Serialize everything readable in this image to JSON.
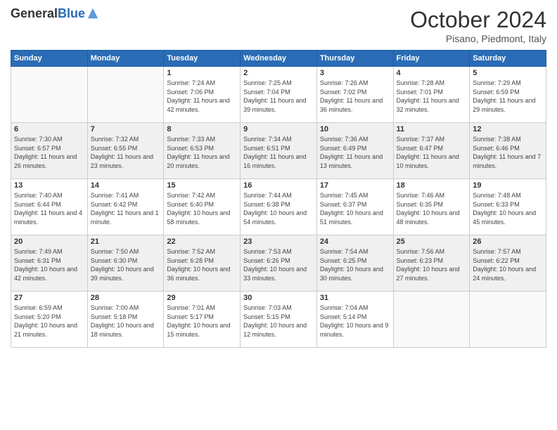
{
  "header": {
    "logo_general": "General",
    "logo_blue": "Blue",
    "title": "October 2024",
    "location": "Pisano, Piedmont, Italy"
  },
  "weekdays": [
    "Sunday",
    "Monday",
    "Tuesday",
    "Wednesday",
    "Thursday",
    "Friday",
    "Saturday"
  ],
  "weeks": [
    {
      "shade": false,
      "days": [
        {
          "num": "",
          "info": ""
        },
        {
          "num": "",
          "info": ""
        },
        {
          "num": "1",
          "info": "Sunrise: 7:24 AM\nSunset: 7:06 PM\nDaylight: 11 hours and 42 minutes."
        },
        {
          "num": "2",
          "info": "Sunrise: 7:25 AM\nSunset: 7:04 PM\nDaylight: 11 hours and 39 minutes."
        },
        {
          "num": "3",
          "info": "Sunrise: 7:26 AM\nSunset: 7:02 PM\nDaylight: 11 hours and 36 minutes."
        },
        {
          "num": "4",
          "info": "Sunrise: 7:28 AM\nSunset: 7:01 PM\nDaylight: 11 hours and 32 minutes."
        },
        {
          "num": "5",
          "info": "Sunrise: 7:29 AM\nSunset: 6:59 PM\nDaylight: 11 hours and 29 minutes."
        }
      ]
    },
    {
      "shade": true,
      "days": [
        {
          "num": "6",
          "info": "Sunrise: 7:30 AM\nSunset: 6:57 PM\nDaylight: 11 hours and 26 minutes."
        },
        {
          "num": "7",
          "info": "Sunrise: 7:32 AM\nSunset: 6:55 PM\nDaylight: 11 hours and 23 minutes."
        },
        {
          "num": "8",
          "info": "Sunrise: 7:33 AM\nSunset: 6:53 PM\nDaylight: 11 hours and 20 minutes."
        },
        {
          "num": "9",
          "info": "Sunrise: 7:34 AM\nSunset: 6:51 PM\nDaylight: 11 hours and 16 minutes."
        },
        {
          "num": "10",
          "info": "Sunrise: 7:36 AM\nSunset: 6:49 PM\nDaylight: 11 hours and 13 minutes."
        },
        {
          "num": "11",
          "info": "Sunrise: 7:37 AM\nSunset: 6:47 PM\nDaylight: 11 hours and 10 minutes."
        },
        {
          "num": "12",
          "info": "Sunrise: 7:38 AM\nSunset: 6:46 PM\nDaylight: 11 hours and 7 minutes."
        }
      ]
    },
    {
      "shade": false,
      "days": [
        {
          "num": "13",
          "info": "Sunrise: 7:40 AM\nSunset: 6:44 PM\nDaylight: 11 hours and 4 minutes."
        },
        {
          "num": "14",
          "info": "Sunrise: 7:41 AM\nSunset: 6:42 PM\nDaylight: 11 hours and 1 minute."
        },
        {
          "num": "15",
          "info": "Sunrise: 7:42 AM\nSunset: 6:40 PM\nDaylight: 10 hours and 58 minutes."
        },
        {
          "num": "16",
          "info": "Sunrise: 7:44 AM\nSunset: 6:38 PM\nDaylight: 10 hours and 54 minutes."
        },
        {
          "num": "17",
          "info": "Sunrise: 7:45 AM\nSunset: 6:37 PM\nDaylight: 10 hours and 51 minutes."
        },
        {
          "num": "18",
          "info": "Sunrise: 7:46 AM\nSunset: 6:35 PM\nDaylight: 10 hours and 48 minutes."
        },
        {
          "num": "19",
          "info": "Sunrise: 7:48 AM\nSunset: 6:33 PM\nDaylight: 10 hours and 45 minutes."
        }
      ]
    },
    {
      "shade": true,
      "days": [
        {
          "num": "20",
          "info": "Sunrise: 7:49 AM\nSunset: 6:31 PM\nDaylight: 10 hours and 42 minutes."
        },
        {
          "num": "21",
          "info": "Sunrise: 7:50 AM\nSunset: 6:30 PM\nDaylight: 10 hours and 39 minutes."
        },
        {
          "num": "22",
          "info": "Sunrise: 7:52 AM\nSunset: 6:28 PM\nDaylight: 10 hours and 36 minutes."
        },
        {
          "num": "23",
          "info": "Sunrise: 7:53 AM\nSunset: 6:26 PM\nDaylight: 10 hours and 33 minutes."
        },
        {
          "num": "24",
          "info": "Sunrise: 7:54 AM\nSunset: 6:25 PM\nDaylight: 10 hours and 30 minutes."
        },
        {
          "num": "25",
          "info": "Sunrise: 7:56 AM\nSunset: 6:23 PM\nDaylight: 10 hours and 27 minutes."
        },
        {
          "num": "26",
          "info": "Sunrise: 7:57 AM\nSunset: 6:22 PM\nDaylight: 10 hours and 24 minutes."
        }
      ]
    },
    {
      "shade": false,
      "days": [
        {
          "num": "27",
          "info": "Sunrise: 6:59 AM\nSunset: 5:20 PM\nDaylight: 10 hours and 21 minutes."
        },
        {
          "num": "28",
          "info": "Sunrise: 7:00 AM\nSunset: 5:18 PM\nDaylight: 10 hours and 18 minutes."
        },
        {
          "num": "29",
          "info": "Sunrise: 7:01 AM\nSunset: 5:17 PM\nDaylight: 10 hours and 15 minutes."
        },
        {
          "num": "30",
          "info": "Sunrise: 7:03 AM\nSunset: 5:15 PM\nDaylight: 10 hours and 12 minutes."
        },
        {
          "num": "31",
          "info": "Sunrise: 7:04 AM\nSunset: 5:14 PM\nDaylight: 10 hours and 9 minutes."
        },
        {
          "num": "",
          "info": ""
        },
        {
          "num": "",
          "info": ""
        }
      ]
    }
  ]
}
